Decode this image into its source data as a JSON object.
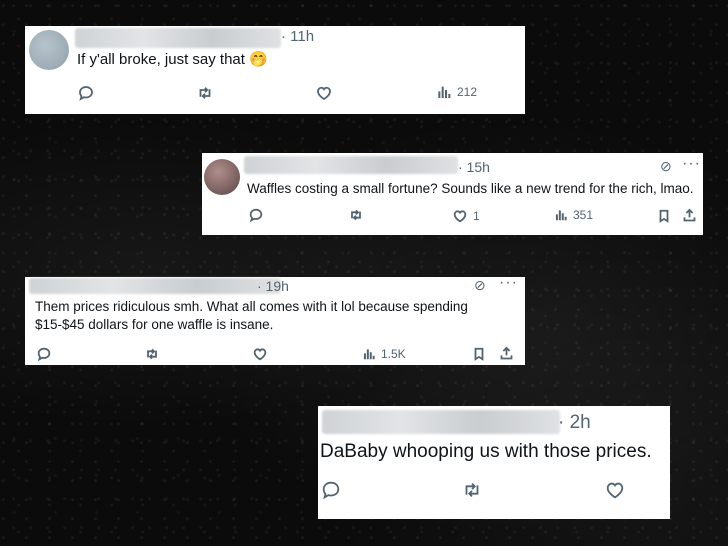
{
  "tweets": [
    {
      "time": "· 11h",
      "text": "If y'all broke, just say that 🤭",
      "views": "212"
    },
    {
      "time": "· 15h",
      "text": "Waffles costing a small fortune? Sounds like a new trend for the rich, lmao.",
      "likes": "1",
      "views": "351"
    },
    {
      "time": "· 19h",
      "text": "Them prices ridiculous smh. What all comes with it lol because spending $15-$45 dollars for one waffle is insane.",
      "views": "1.5K"
    },
    {
      "time": "· 2h",
      "text": "DaBaby whooping us with those prices."
    }
  ],
  "colors": {
    "background": "#0b0b0b",
    "card": "#ffffff",
    "muted": "#536471",
    "text": "#0f1419"
  },
  "icons": [
    "reply-icon",
    "retweet-icon",
    "like-icon",
    "views-icon",
    "bookmark-icon",
    "share-icon",
    "grok-icon",
    "more-icon"
  ]
}
